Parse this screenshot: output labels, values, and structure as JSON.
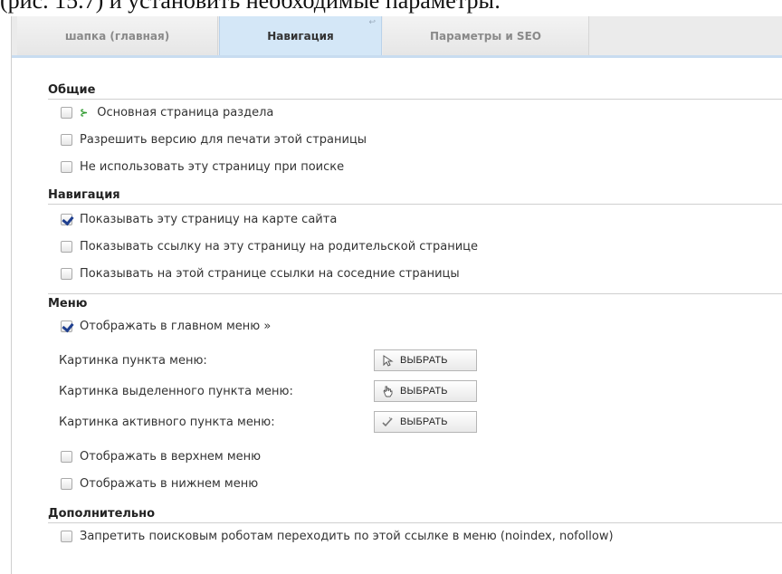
{
  "document": {
    "top_text": "(рис. 15.7) и установить необходимые параметры:"
  },
  "tabs": [
    {
      "label": "шапка (главная)",
      "active": false
    },
    {
      "label": "Навигация",
      "active": true
    },
    {
      "label": "Параметры и SEO",
      "active": false
    }
  ],
  "sections": {
    "general": {
      "title": "Общие",
      "options": [
        {
          "label": "Основная страница раздела",
          "checked": false,
          "icon": "leaf-icon"
        },
        {
          "label": "Разрешить версию для печати этой страницы",
          "checked": false
        },
        {
          "label": "Не использовать эту страницу при поиске",
          "checked": false
        }
      ]
    },
    "navigation": {
      "title": "Навигация",
      "options": [
        {
          "label": "Показывать эту страницу на карте сайта",
          "checked": true
        },
        {
          "label": "Показывать ссылку на эту страницу на родительской странице",
          "checked": false
        },
        {
          "label": "Показывать на этой странице ссылки на соседние страницы",
          "checked": false
        }
      ]
    },
    "menu": {
      "title": "Меню",
      "show_in_main": {
        "label": "Отображать в главном меню »",
        "checked": true
      },
      "images": [
        {
          "label": "Картинка пункта меню:",
          "button": "ВЫБРАТЬ",
          "icon": "cursor-icon"
        },
        {
          "label": "Картинка выделенного пункта меню:",
          "button": "ВЫБРАТЬ",
          "icon": "hand-icon"
        },
        {
          "label": "Картинка активного пункта меню:",
          "button": "ВЫБРАТЬ",
          "icon": "check-pencil-icon"
        }
      ],
      "extra": [
        {
          "label": "Отображать в верхнем меню",
          "checked": false
        },
        {
          "label": "Отображать в нижнем меню",
          "checked": false
        }
      ]
    },
    "additional": {
      "title": "Дополнительно",
      "options": [
        {
          "label": "Запретить поисковым роботам переходить по этой ссылке в меню (noindex, nofollow)",
          "checked": false
        }
      ]
    }
  }
}
